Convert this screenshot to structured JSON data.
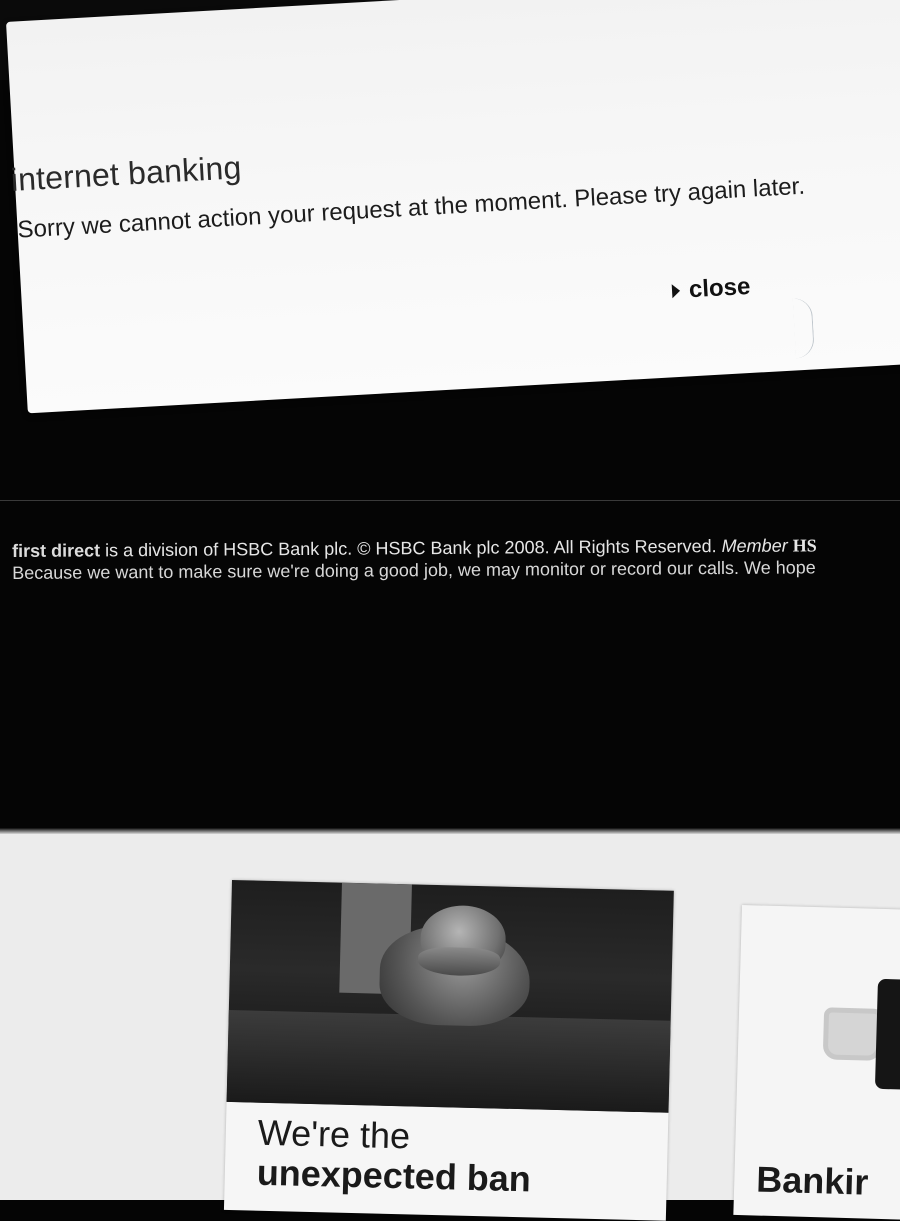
{
  "dialog": {
    "title": "internet banking",
    "message": "Sorry we cannot action your request at the moment. Please try again later.",
    "close_label": "close"
  },
  "footer": {
    "brand": "first direct",
    "line1_text": " is a division of HSBC Bank plc. © HSBC Bank plc 2008. All Rights Reserved. ",
    "member": "Member ",
    "member_tail": "HS",
    "line2": "Because we want to make sure we're doing a good job, we may monitor or record our calls. We hope"
  },
  "promo_cards": [
    {
      "heading_line1": "We're the",
      "heading_line2": "unexpected ban",
      "image": "platypus-photo"
    },
    {
      "heading": "Bankir",
      "icons": [
        "telephone-icon",
        "mobile-phone-icon"
      ]
    }
  ]
}
